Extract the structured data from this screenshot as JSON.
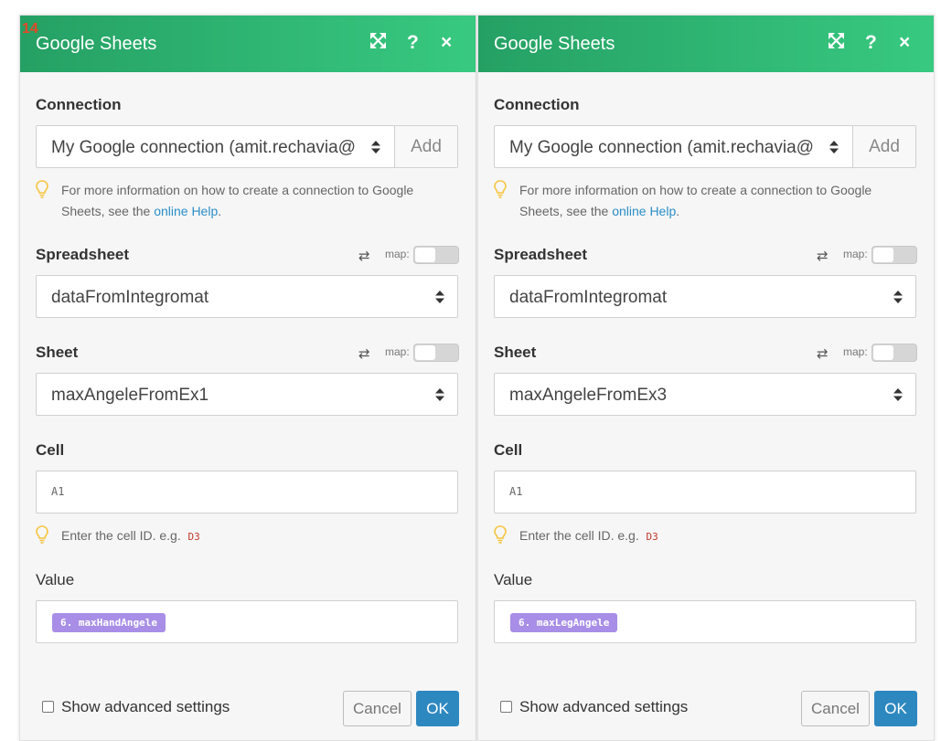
{
  "panels": [
    {
      "badge": "14",
      "title": "Google Sheets",
      "icons": {
        "expand": "expand-icon",
        "help": "help-icon",
        "close": "close-icon"
      },
      "header_buttons": {
        "help": "?",
        "close": "×"
      },
      "connection": {
        "label": "Connection",
        "value": "My Google connection (amit.rechavia@",
        "add_label": "Add",
        "hint_before": "For more information on how to create a connection to Google",
        "hint_line2_before": "Sheets, see the ",
        "hint_link": "online Help",
        "hint_after": "."
      },
      "spreadsheet": {
        "label": "Spreadsheet",
        "map_label": "map:",
        "value": "dataFromIntegromat"
      },
      "sheet": {
        "label": "Sheet",
        "map_label": "map:",
        "value": "maxAngeleFromEx1"
      },
      "cell": {
        "label": "Cell",
        "value": "A1",
        "hint_before": "Enter the cell ID. e.g.",
        "hint_code": "D3"
      },
      "value_field": {
        "label": "Value",
        "pill": "6. maxHandAngele"
      },
      "footer": {
        "advanced_label": "Show advanced settings",
        "advanced_checked": false,
        "cancel_label": "Cancel",
        "ok_label": "OK"
      }
    },
    {
      "title": "Google Sheets",
      "icons": {
        "expand": "expand-icon",
        "help": "help-icon",
        "close": "close-icon"
      },
      "header_buttons": {
        "help": "?",
        "close": "×"
      },
      "connection": {
        "label": "Connection",
        "value": "My Google connection (amit.rechavia@",
        "add_label": "Add",
        "hint_before": "For more information on how to create a connection to Google",
        "hint_line2_before": "Sheets, see the ",
        "hint_link": "online Help",
        "hint_after": "."
      },
      "spreadsheet": {
        "label": "Spreadsheet",
        "map_label": "map:",
        "value": "dataFromIntegromat"
      },
      "sheet": {
        "label": "Sheet",
        "map_label": "map:",
        "value": "maxAngeleFromEx3"
      },
      "cell": {
        "label": "Cell",
        "value": "A1",
        "hint_before": "Enter the cell ID. e.g.",
        "hint_code": "D3"
      },
      "value_field": {
        "label": "Value",
        "pill": "6. maxLegAngele"
      },
      "footer": {
        "advanced_label": "Show advanced settings",
        "advanced_checked": false,
        "cancel_label": "Cancel",
        "ok_label": "OK"
      }
    }
  ],
  "colors": {
    "header_start": "#25a064",
    "header_end": "#38c980",
    "badge": "#e14a28",
    "link": "#2b8ec7",
    "pill": "#a88ee6",
    "ok_button": "#2e88c0",
    "hint_bulb": "#f5c542"
  }
}
